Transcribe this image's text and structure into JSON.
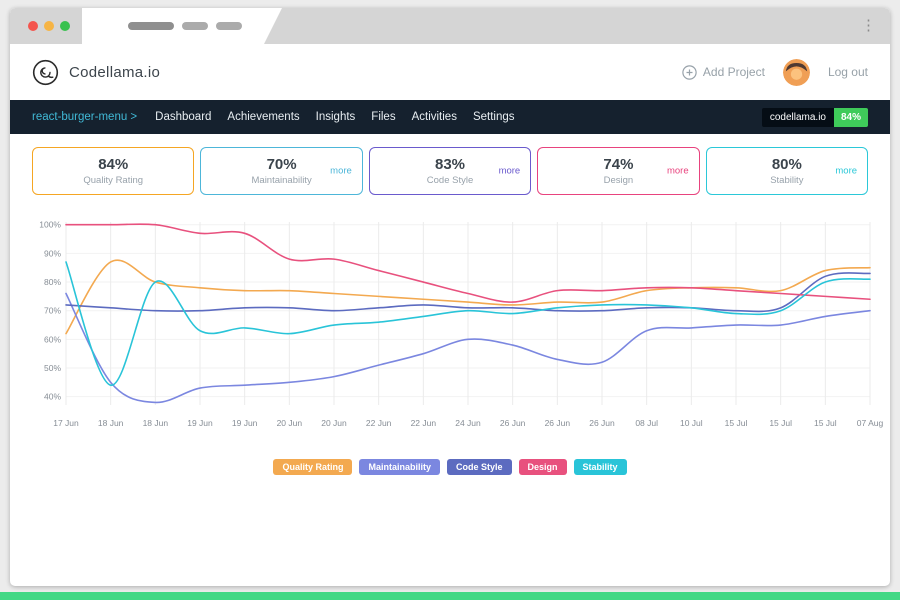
{
  "browser": {
    "traffic_lights": [
      "close",
      "minimize",
      "zoom"
    ],
    "menu_icon": "⋮"
  },
  "header": {
    "logo_text": "Codellama.io",
    "add_project_label": "Add Project",
    "logout_label": "Log out"
  },
  "nav": {
    "project_link": "react-burger-menu >",
    "items": [
      "Dashboard",
      "Achievements",
      "Insights",
      "Files",
      "Activities",
      "Settings"
    ],
    "badge": {
      "label": "codellama.io",
      "value": "84%",
      "value_color": "#3fcb5a"
    }
  },
  "cards": [
    {
      "value": "84%",
      "label": "Quality Rating",
      "more": "",
      "accent": "#f5a623"
    },
    {
      "value": "70%",
      "label": "Maintainability",
      "more": "more",
      "accent": "#4db6d9"
    },
    {
      "value": "83%",
      "label": "Code Style",
      "more": "more",
      "accent": "#6a5acd"
    },
    {
      "value": "74%",
      "label": "Design",
      "more": "more",
      "accent": "#e8437e"
    },
    {
      "value": "80%",
      "label": "Stability",
      "more": "more",
      "accent": "#2bc8d8"
    }
  ],
  "chart_data": {
    "type": "line",
    "x": [
      "17 Jun",
      "18 Jun",
      "18 Jun",
      "19 Jun",
      "19 Jun",
      "20 Jun",
      "20 Jun",
      "22 Jun",
      "22 Jun",
      "24 Jun",
      "26 Jun",
      "26 Jun",
      "26 Jun",
      "08 Jul",
      "10 Jul",
      "15 Jul",
      "15 Jul",
      "15 Jul",
      "07 Aug"
    ],
    "y_tick_labels": [
      "100%",
      "90%",
      "80%",
      "70%",
      "60%",
      "50%",
      "40%"
    ],
    "ylim": [
      35,
      102
    ],
    "grid": true,
    "legend_position": "bottom",
    "series": [
      {
        "name": "Quality Rating",
        "color": "#f3a950",
        "values": [
          62,
          87,
          80,
          78,
          77,
          77,
          76,
          75,
          74,
          73,
          72,
          73,
          73,
          77,
          78,
          78,
          77,
          84,
          85
        ]
      },
      {
        "name": "Maintainability",
        "color": "#7b87e0",
        "values": [
          76,
          45,
          38,
          43,
          44,
          45,
          47,
          51,
          55,
          60,
          58,
          53,
          52,
          63,
          64,
          65,
          65,
          68,
          70
        ]
      },
      {
        "name": "Code Style",
        "color": "#5c6bc0",
        "values": [
          72,
          71,
          70,
          70,
          71,
          71,
          70,
          71,
          72,
          71,
          71,
          70,
          70,
          71,
          71,
          70,
          71,
          82,
          83
        ]
      },
      {
        "name": "Design",
        "color": "#e8517e",
        "values": [
          100,
          100,
          100,
          97,
          97,
          88,
          88,
          84,
          80,
          76,
          73,
          77,
          77,
          78,
          78,
          77,
          76,
          75,
          74
        ]
      },
      {
        "name": "Stability",
        "color": "#29c4d8",
        "values": [
          87,
          44,
          80,
          63,
          64,
          62,
          65,
          66,
          68,
          70,
          69,
          71,
          72,
          72,
          71,
          69,
          70,
          80,
          81
        ]
      }
    ]
  },
  "colors": {
    "nav_bg": "#15212e",
    "nav_link": "#41b9d6",
    "page_strip": "#42d885",
    "grid_line": "#ebebeb",
    "axis_text": "#868d95"
  }
}
